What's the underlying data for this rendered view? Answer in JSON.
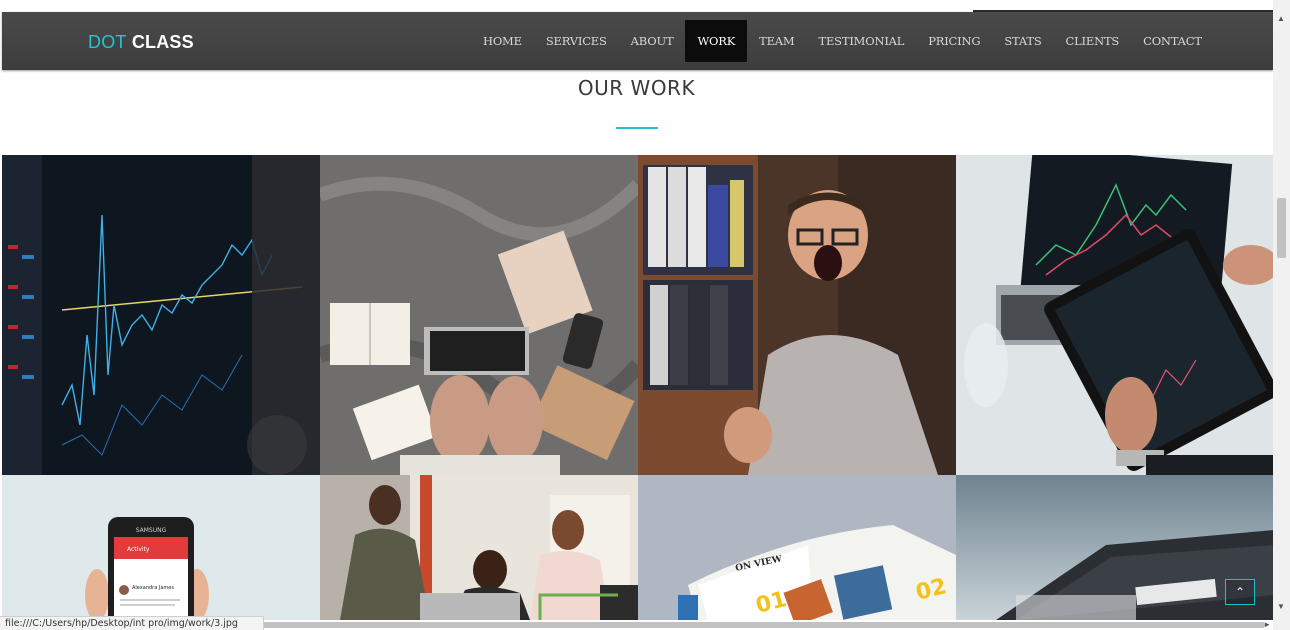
{
  "brand": {
    "part1": "DOT",
    "part2": "CLASS"
  },
  "nav": [
    {
      "label": "HOME",
      "active": false
    },
    {
      "label": "SERVICES",
      "active": false
    },
    {
      "label": "ABOUT",
      "active": false
    },
    {
      "label": "WORK",
      "active": true
    },
    {
      "label": "TEAM",
      "active": false
    },
    {
      "label": "TESTIMONIAL",
      "active": false
    },
    {
      "label": "PRICING",
      "active": false
    },
    {
      "label": "STATS",
      "active": false
    },
    {
      "label": "CLIENTS",
      "active": false
    },
    {
      "label": "CONTACT",
      "active": false
    }
  ],
  "section": {
    "title": "OUR WORK"
  },
  "gallery": [
    {
      "icon": "stock-chart-screen-image"
    },
    {
      "icon": "laptop-on-bed-image"
    },
    {
      "icon": "excited-man-image"
    },
    {
      "icon": "tablet-trading-chart-image"
    },
    {
      "icon": "smartphone-app-image"
    },
    {
      "icon": "women-meeting-image"
    },
    {
      "icon": "open-magazine-image"
    },
    {
      "icon": "laptop-keyboard-image"
    }
  ],
  "magazine": {
    "label": "ON VIEW",
    "num1": "01",
    "num2": "02"
  },
  "phone": {
    "brand": "SAMSUNG",
    "app_title": "Activity",
    "contact": "Alexandra James"
  },
  "statusbar": {
    "url": "file:///C:/Users/hp/Desktop/int pro/img/work/3.jpg"
  },
  "back_to_top": {
    "icon": "chevron-up-icon"
  },
  "colors": {
    "accent": "#1fc0c9",
    "navbar": "#444444",
    "active_nav": "#0c0c0c"
  }
}
